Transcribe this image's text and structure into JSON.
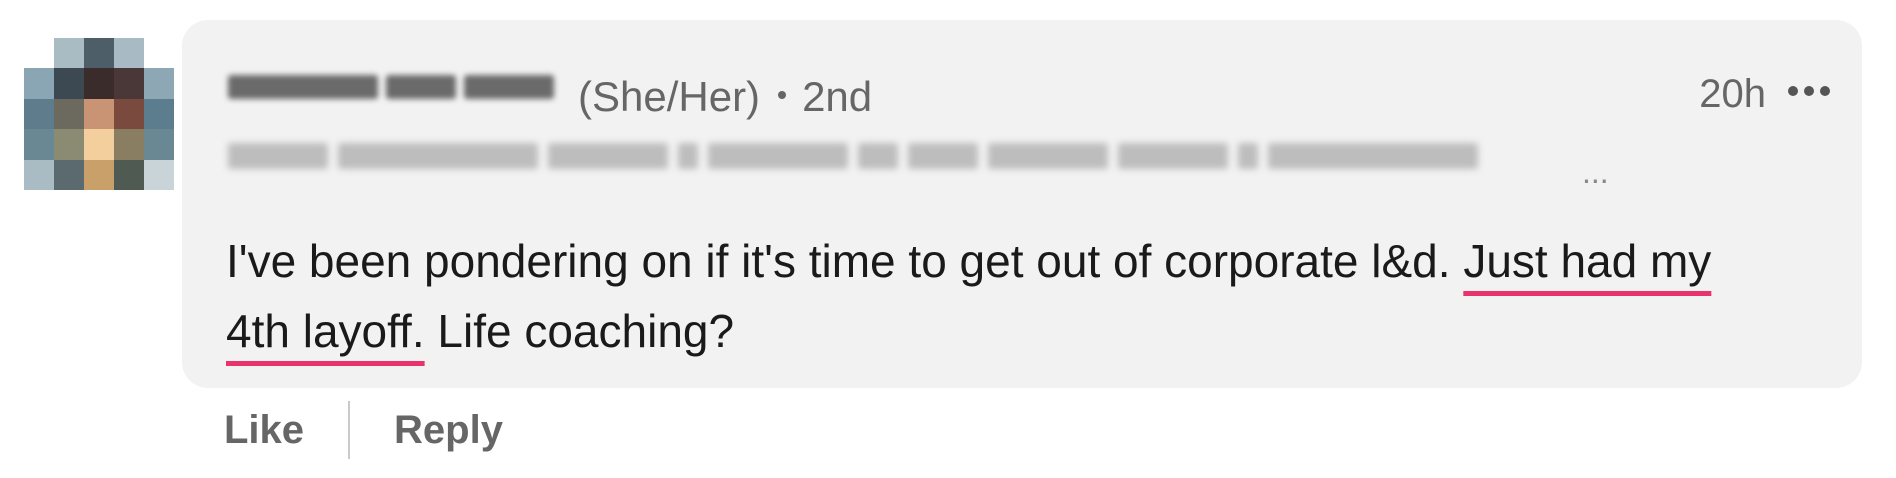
{
  "comment": {
    "author": {
      "pronouns": "(She/Her)",
      "connection_degree": "2nd"
    },
    "timestamp": "20h",
    "text_before": "I've been pondering on if it's time to get out of corporate l&d. ",
    "text_highlight": "Just had my 4th layoff.",
    "text_after": " Life coaching?",
    "headline_truncation": "...",
    "highlight_color": "#e8336d",
    "bubble_color": "#f2f2f2"
  },
  "icons": {
    "more": "more-options-icon"
  },
  "actions": {
    "like_label": "Like",
    "reply_label": "Reply"
  }
}
